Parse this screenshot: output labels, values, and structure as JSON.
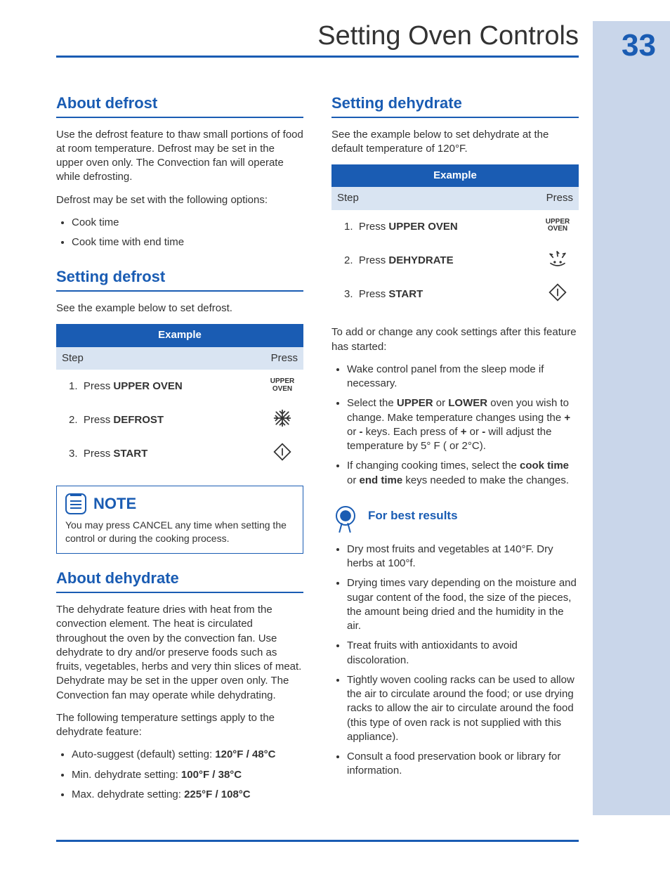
{
  "header": {
    "title": "Setting Oven Controls",
    "page": "33"
  },
  "left": {
    "h_about_defrost": "About defrost",
    "p_defrost1": "Use the defrost feature to thaw small portions of food at room temperature. Defrost may be set in the upper oven only. The Convection fan will operate while defrosting.",
    "p_defrost2": "Defrost may be set with the following options:",
    "defrost_opts": {
      "a": "Cook time",
      "b": "Cook time with end time"
    },
    "h_setting_defrost": "Setting defrost",
    "p_setdef": "See the example below to set defrost.",
    "table1": {
      "title": "Example",
      "col_step": "Step",
      "col_press": "Press",
      "r1_num": "1.",
      "r1_txt": "Press ",
      "r1_bold": "UPPER OVEN",
      "r1_icon": "UPPER\nOVEN",
      "r2_num": "2.",
      "r2_txt": "Press ",
      "r2_bold": "DEFROST",
      "r3_num": "3.",
      "r3_txt": "Press ",
      "r3_bold": "START"
    },
    "note_title": "NOTE",
    "note_body": "You may press CANCEL any time when setting the control or during the cooking process.",
    "h_about_dehydrate": "About dehydrate",
    "p_dehy1": "The dehydrate feature dries with heat from the convection element. The heat is circulated throughout the oven by the convection fan. Use dehydrate to dry and/or preserve foods such as fruits, vegetables, herbs and very thin slices of meat. Dehydrate may be set in the upper oven only. The Convection fan may operate while dehydrating.",
    "p_dehy2": "The following temperature settings apply to the dehydrate feature:",
    "dehy_opts": {
      "a_pre": "Auto-suggest (default) setting: ",
      "a_bold": "120°F / 48°C",
      "b_pre": "Min. dehydrate setting:  ",
      "b_bold": "100°F / 38°C",
      "c_pre": "Max. dehydrate setting:  ",
      "c_bold": "225°F / 108°C"
    }
  },
  "right": {
    "h_setting_dehydrate": "Setting dehydrate",
    "p_setdehy": "See the example below to set dehydrate at the default temperature of 120°F.",
    "table2": {
      "title": "Example",
      "col_step": "Step",
      "col_press": "Press",
      "r1_num": "1.",
      "r1_txt": "Press ",
      "r1_bold": "UPPER OVEN",
      "r1_icon": "UPPER\nOVEN",
      "r2_num": "2.",
      "r2_txt": "Press ",
      "r2_bold": "DEHYDRATE",
      "r3_num": "3.",
      "r3_txt": "Press ",
      "r3_bold": "START"
    },
    "p_after": "To add or change any cook settings after this feature has started:",
    "after_list": {
      "a": "Wake control panel from the sleep mode if necessary.",
      "b_pre": "Select the ",
      "b_b1": "UPPER",
      "b_mid1": " or ",
      "b_b2": "LOWER",
      "b_mid2": " oven you wish to change. Make temperature changes using the ",
      "b_b3": "+",
      "b_mid3": " or ",
      "b_b4": "-",
      "b_mid4": " keys. Each press of ",
      "b_b5": "+",
      "b_mid5": " or ",
      "b_b6": "-",
      "b_end": " will adjust the temperature by 5° F ( or 2°C).",
      "c_pre": "If changing cooking times, select the ",
      "c_b1": "cook time",
      "c_mid": " or ",
      "c_b2": "end time",
      "c_end": " keys needed to make the changes."
    },
    "best_title": "For best results",
    "best_list": {
      "a": "Dry most fruits and vegetables at 140°F. Dry herbs at 100°f.",
      "b": "Drying times vary depending on the moisture and sugar content of the food, the size of the pieces, the amount being dried and the humidity in the air.",
      "c": "Treat fruits with antioxidants to avoid discoloration.",
      "d": "Tightly woven cooling racks can be used to allow the air to circulate around the food; or use drying racks to allow the air to circulate around the food (this type of oven rack is not supplied with this appliance).",
      "e": "Consult a food preservation book or library for information."
    }
  }
}
